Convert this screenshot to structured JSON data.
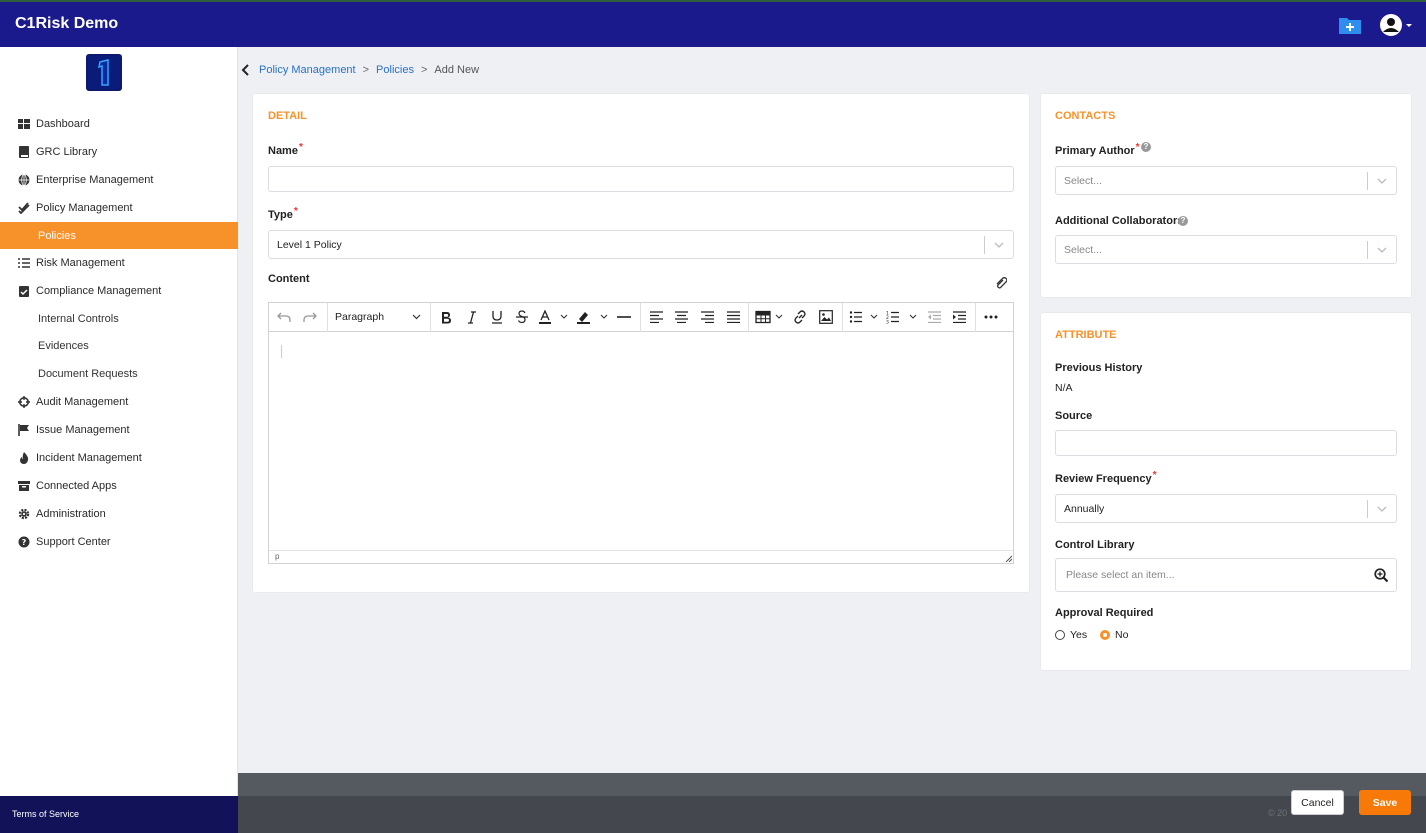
{
  "app": {
    "title": "C1Risk Demo"
  },
  "header": {
    "add_folder_icon": "folder-plus-icon",
    "user_icon": "user-circle-icon"
  },
  "sidebar": {
    "items": [
      {
        "label": "Dashboard",
        "icon": "dashboard-icon"
      },
      {
        "label": "GRC Library",
        "icon": "book-icon"
      },
      {
        "label": "Enterprise Management",
        "icon": "globe-icon"
      },
      {
        "label": "Policy Management",
        "icon": "double-check-icon"
      },
      {
        "label": "Policies",
        "sub": true,
        "active": true
      },
      {
        "label": "Risk Management",
        "icon": "list-icon"
      },
      {
        "label": "Compliance Management",
        "icon": "clipboard-check-icon"
      },
      {
        "label": "Internal Controls",
        "sub": true
      },
      {
        "label": "Evidences",
        "sub": true
      },
      {
        "label": "Document Requests",
        "sub": true
      },
      {
        "label": "Audit Management",
        "icon": "crosshair-icon"
      },
      {
        "label": "Issue Management",
        "icon": "flag-icon"
      },
      {
        "label": "Incident Management",
        "icon": "fire-icon"
      },
      {
        "label": "Connected Apps",
        "icon": "archive-icon"
      },
      {
        "label": "Administration",
        "icon": "gear-icon"
      },
      {
        "label": "Support Center",
        "icon": "question-circle-icon"
      }
    ],
    "terms": "Terms of Service"
  },
  "breadcrumb": {
    "items": [
      "Policy Management",
      "Policies",
      "Add New"
    ],
    "separator": ">"
  },
  "detail": {
    "section_title": "DETAIL",
    "name_label": "Name",
    "name_value": "",
    "type_label": "Type",
    "type_value": "Level 1 Policy",
    "content_label": "Content",
    "editor": {
      "block_format": "Paragraph",
      "status_path": "p"
    }
  },
  "contacts": {
    "section_title": "CONTACTS",
    "primary_author_label": "Primary Author",
    "primary_author_placeholder": "Select...",
    "collaborators_label": "Additional Collaborators",
    "collaborators_placeholder": "Select..."
  },
  "attribute": {
    "section_title": "ATTRIBUTE",
    "previous_history_label": "Previous History",
    "previous_history_value": "N/A",
    "source_label": "Source",
    "source_value": "",
    "review_frequency_label": "Review Frequency",
    "review_frequency_value": "Annually",
    "control_library_label": "Control Library",
    "control_library_placeholder": "Please select an item...",
    "approval_label": "Approval Required",
    "approval_options": [
      "Yes",
      "No"
    ],
    "approval_selected": "No"
  },
  "footer": {
    "copyright": "© 20",
    "cancel": "Cancel",
    "save": "Save"
  },
  "colors": {
    "header": "#1a1a8c",
    "accent": "#f7922b",
    "link": "#2872c6",
    "save": "#f77a08"
  },
  "required_marker": "*"
}
